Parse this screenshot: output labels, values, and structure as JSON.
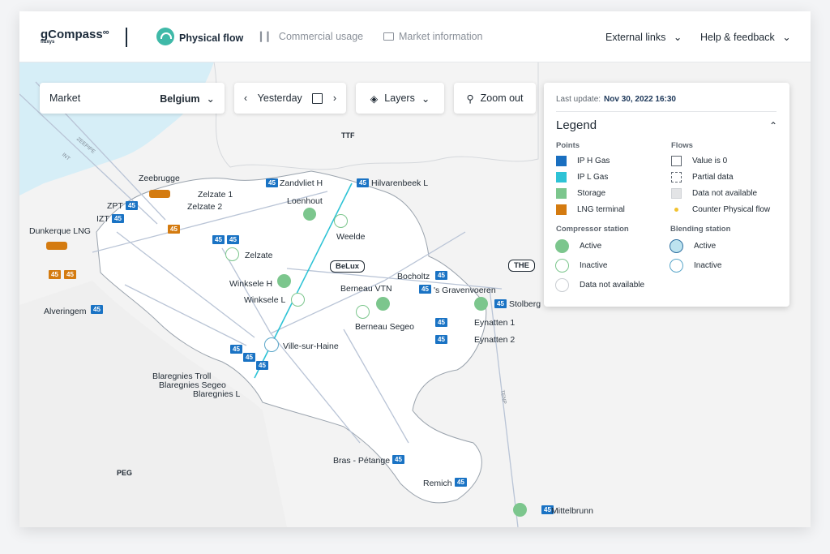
{
  "header": {
    "logo": "gCompass",
    "logo_sub": "fluxys",
    "nav": [
      {
        "label": "Physical flow"
      },
      {
        "label": "Commercial usage"
      },
      {
        "label": "Market information"
      }
    ],
    "external_links": "External links",
    "help": "Help & feedback"
  },
  "controls": {
    "market_label": "Market",
    "market_value": "Belgium",
    "date_value": "Yesterday",
    "layers_label": "Layers",
    "zoom_label": "Zoom out"
  },
  "legend": {
    "last_update_label": "Last update:",
    "last_update_value": "Nov 30, 2022 16:30",
    "title": "Legend",
    "points_title": "Points",
    "points": [
      {
        "label": "IP H Gas",
        "color": "#1a6fc0"
      },
      {
        "label": "IP L Gas",
        "color": "#2ec3d6"
      },
      {
        "label": "Storage",
        "color": "#7cc68d"
      },
      {
        "label": "LNG terminal",
        "color": "#d47b10"
      }
    ],
    "flows_title": "Flows",
    "flows": [
      {
        "label": "Value is 0"
      },
      {
        "label": "Partial data"
      },
      {
        "label": "Data not available"
      },
      {
        "label": "Counter Physical flow"
      }
    ],
    "compressor_title": "Compressor station",
    "compressor": [
      {
        "label": "Active"
      },
      {
        "label": "Inactive"
      },
      {
        "label": "Data not available"
      }
    ],
    "blending_title": "Blending station",
    "blending": [
      {
        "label": "Active"
      },
      {
        "label": "Inactive"
      }
    ]
  },
  "map": {
    "hubs": {
      "ttf": "TTF",
      "the": "THE",
      "belux": "BeLux",
      "peg": "PEG"
    },
    "pipelines": {
      "zeepipe": "ZEEPIPE",
      "int": "INT",
      "tenp": "TENP"
    },
    "badge_value": "45",
    "labels": {
      "zeebrugge": "Zeebrugge",
      "zpt": "ZPT",
      "izt": "IZT",
      "dunkerque": "Dunkerque LNG",
      "zelzate1": "Zelzate 1",
      "zelzate2": "Zelzate 2",
      "zelzate": "Zelzate",
      "zandvliet": "Zandvliet H",
      "loenhout": "Loenhout",
      "hilvarenbeek": "Hilvarenbeek L",
      "weelde": "Weelde",
      "winksele_h": "Winksele H",
      "winksele_l": "Winksele L",
      "alveringem": "Alveringem",
      "berneau_vtn": "Berneau VTN",
      "berneau_segeo": "Berneau Segeo",
      "bocholtz": "Bocholtz",
      "gravenvoeren": "'s Gravenvoeren",
      "stolberg": "Stolberg",
      "eynatten1": "Eynatten 1",
      "eynatten2": "Eynatten 2",
      "ville": "Ville-sur-Haine",
      "blaregnies_troll": "Blaregnies Troll",
      "blaregnies_segeo": "Blaregnies Segeo",
      "blaregnies_l": "Blaregnies L",
      "bras": "Bras - Pétange",
      "remich": "Remich",
      "mittelbrunn": "Mittelbrunn"
    }
  }
}
